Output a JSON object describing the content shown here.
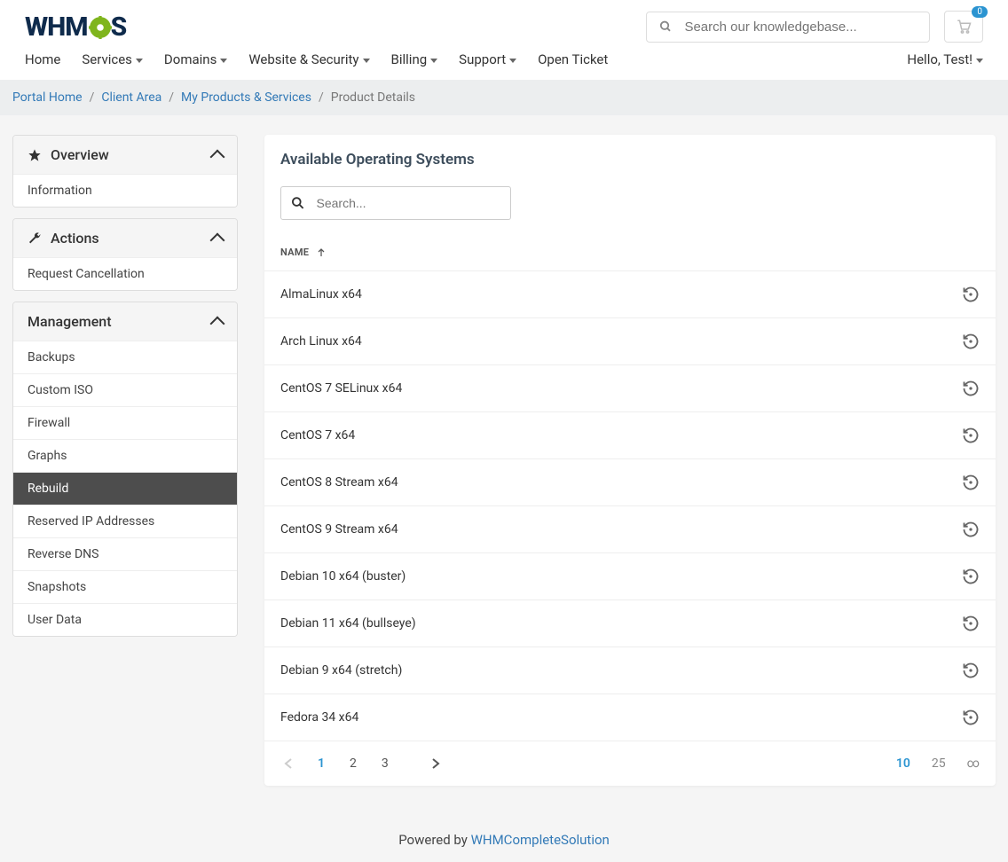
{
  "header": {
    "logo_text_prefix": "WHM",
    "logo_text_suffix": "S",
    "search_placeholder": "Search our knowledgebase...",
    "cart_count": "0"
  },
  "nav": {
    "items": [
      {
        "label": "Home",
        "dropdown": false
      },
      {
        "label": "Services",
        "dropdown": true
      },
      {
        "label": "Domains",
        "dropdown": true
      },
      {
        "label": "Website & Security",
        "dropdown": true
      },
      {
        "label": "Billing",
        "dropdown": true
      },
      {
        "label": "Support",
        "dropdown": true
      },
      {
        "label": "Open Ticket",
        "dropdown": false
      }
    ],
    "user_greeting": "Hello, Test!"
  },
  "breadcrumb": {
    "items": [
      {
        "label": "Portal Home",
        "link": true
      },
      {
        "label": "Client Area",
        "link": true
      },
      {
        "label": "My Products & Services",
        "link": true
      },
      {
        "label": "Product Details",
        "link": false
      }
    ]
  },
  "sidebar": {
    "sections": [
      {
        "title": "Overview",
        "icon": "star",
        "items": [
          {
            "label": "Information",
            "active": false
          }
        ]
      },
      {
        "title": "Actions",
        "icon": "wrench",
        "items": [
          {
            "label": "Request Cancellation",
            "active": false
          }
        ]
      },
      {
        "title": "Management",
        "icon": "none",
        "items": [
          {
            "label": "Backups",
            "active": false
          },
          {
            "label": "Custom ISO",
            "active": false
          },
          {
            "label": "Firewall",
            "active": false
          },
          {
            "label": "Graphs",
            "active": false
          },
          {
            "label": "Rebuild",
            "active": true
          },
          {
            "label": "Reserved IP Addresses",
            "active": false
          },
          {
            "label": "Reverse DNS",
            "active": false
          },
          {
            "label": "Snapshots",
            "active": false
          },
          {
            "label": "User Data",
            "active": false
          }
        ]
      }
    ]
  },
  "main": {
    "title": "Available Operating Systems",
    "search_placeholder": "Search...",
    "column_header": "NAME",
    "os_list": [
      "AlmaLinux x64",
      "Arch Linux x64",
      "CentOS 7 SELinux x64",
      "CentOS 7 x64",
      "CentOS 8 Stream x64",
      "CentOS 9 Stream x64",
      "Debian 10 x64 (buster)",
      "Debian 11 x64 (bullseye)",
      "Debian 9 x64 (stretch)",
      "Fedora 34 x64"
    ],
    "pages": [
      "1",
      "2",
      "3"
    ],
    "active_page": "1",
    "page_sizes": [
      "10",
      "25",
      "∞"
    ],
    "active_page_size": "10"
  },
  "footer": {
    "prefix": "Powered by ",
    "link_text": "WHMCompleteSolution"
  }
}
